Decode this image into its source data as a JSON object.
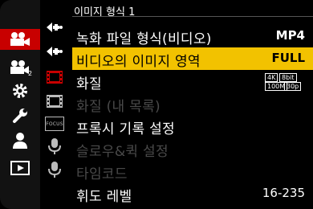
{
  "sidebar": {
    "items": [
      {
        "icon": "video-camera-icon",
        "active": true
      },
      {
        "icon": "video-camera-2-icon",
        "active": false,
        "sub": "2"
      },
      {
        "icon": "gear-icon",
        "active": false
      },
      {
        "icon": "wrench-icon",
        "active": false
      },
      {
        "icon": "person-icon",
        "active": false
      },
      {
        "icon": "playback-icon",
        "active": false
      }
    ]
  },
  "subtabs": [
    {
      "icon": "plus-star-icon",
      "active": true
    },
    {
      "icon": "plus-star-icon",
      "active": false
    },
    {
      "icon": "film-red-icon",
      "active": false
    },
    {
      "icon": "film-icon",
      "active": false
    },
    {
      "icon": "focus-icon",
      "active": false,
      "text": "FOCUS"
    },
    {
      "icon": "microphone-icon",
      "active": false
    },
    {
      "icon": "microphone-icon",
      "active": false
    }
  ],
  "header": {
    "title": "이미지 형식 1"
  },
  "menu": [
    {
      "label": "녹화 파일 형식(비디오)",
      "value": "MP4",
      "selected": false,
      "disabled": false
    },
    {
      "label": "비디오의 이미지 영역",
      "value": "FULL",
      "selected": true,
      "disabled": false
    },
    {
      "label": "화질",
      "value": "",
      "badge": {
        "top_left": "4K",
        "top_right": "8bit",
        "bottom_left": "100M",
        "bottom_right": "30p"
      },
      "selected": false,
      "disabled": false
    },
    {
      "label": "화질 (내 목록)",
      "value": "",
      "selected": false,
      "disabled": true
    },
    {
      "label": "프록시 기록 설정",
      "value": "",
      "selected": false,
      "disabled": false
    },
    {
      "label": "슬로우&퀵 설정",
      "value": "",
      "selected": false,
      "disabled": true
    },
    {
      "label": "타임코드",
      "value": "",
      "selected": false,
      "disabled": true
    },
    {
      "label": "휘도 레벨",
      "value": "16-235",
      "selected": false,
      "disabled": false
    }
  ],
  "colors": {
    "accent": "#c80000",
    "highlight": "#f2c200",
    "disabled": "#4a4a4a"
  }
}
